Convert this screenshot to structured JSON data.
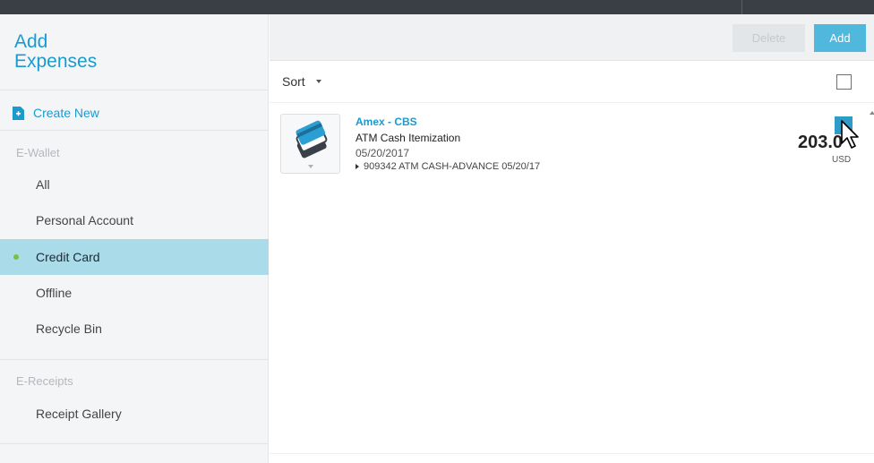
{
  "sidebar": {
    "title_line1": "Add",
    "title_line2": "Expenses",
    "create_new": "Create New",
    "sections": {
      "ewallet": "E-Wallet",
      "ereceipts": "E-Receipts"
    },
    "items": [
      {
        "label": "All",
        "active": false
      },
      {
        "label": "Personal Account",
        "active": false
      },
      {
        "label": "Credit Card",
        "active": true
      },
      {
        "label": "Offline",
        "active": false
      },
      {
        "label": "Recycle Bin",
        "active": false
      }
    ],
    "receipt_gallery": "Receipt Gallery"
  },
  "toolbar": {
    "delete_label": "Delete",
    "add_label": "Add"
  },
  "sort_label": "Sort",
  "expense": {
    "title": "Amex - CBS",
    "subtitle": "ATM Cash Itemization",
    "date": "05/20/2017",
    "detail": "909342 ATM CASH-ADVANCE 05/20/17",
    "amount": "203.0",
    "currency": "USD",
    "selected": true,
    "icon": "credit-card-icon"
  },
  "colors": {
    "accent": "#1a9bd0",
    "active_bg": "#a9dbe8",
    "active_dot": "#7bbf3e",
    "add_button": "#4fb8dc",
    "topbar": "#3a3f45"
  }
}
